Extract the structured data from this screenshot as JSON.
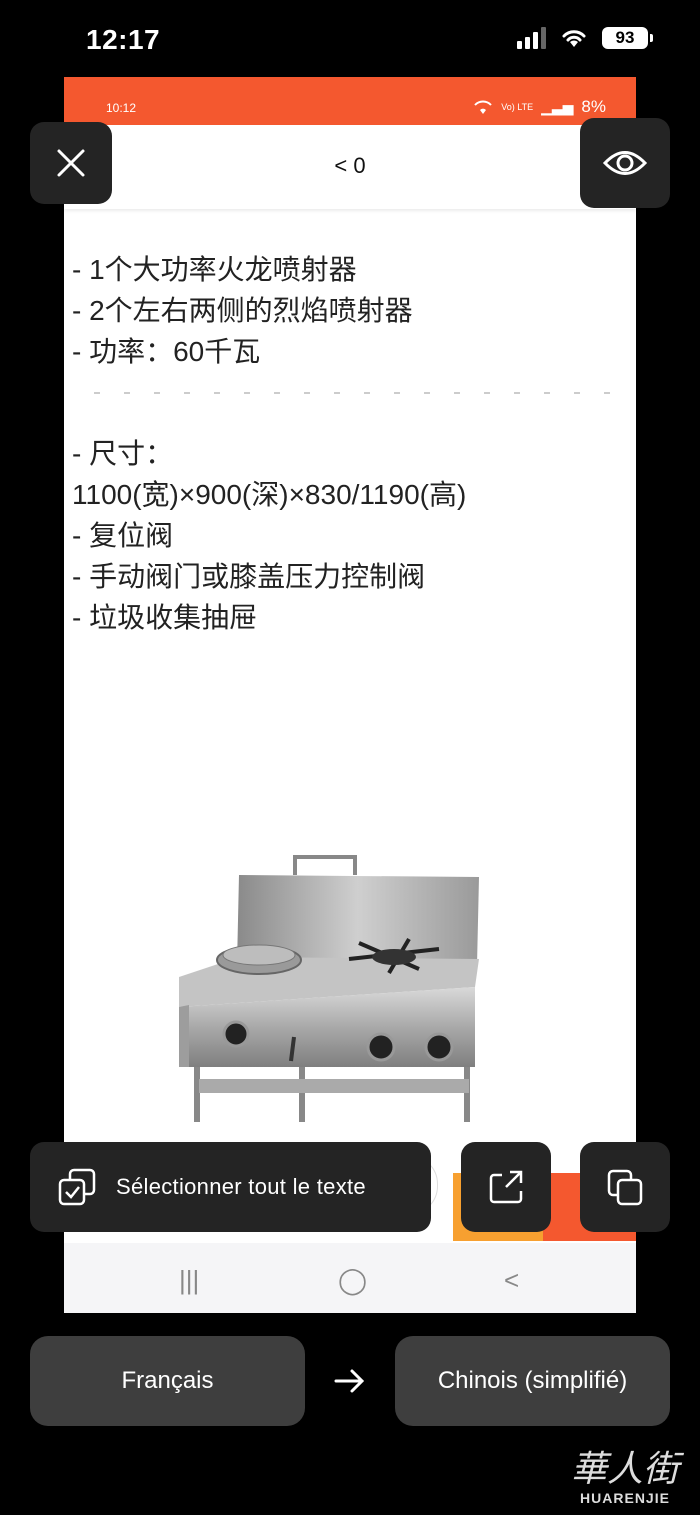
{
  "status_bar": {
    "time": "12:17",
    "battery": "93"
  },
  "screenshot": {
    "inner_status": {
      "time": "10:12",
      "battery": "8%",
      "network": "Vo) LTE"
    },
    "header": {
      "title": "< 0"
    },
    "content_lines": [
      "- 1个大功率火龙喷射器",
      "- 2个左右两侧的烈焰喷射器",
      "- 功率：60千瓦",
      "",
      "- 尺寸：",
      "1100(宽)×900(深)×830/1190(高)",
      "- 复位阀",
      "- 手动阀门或膝盖压力控制阀",
      "- 垃圾收集抽屉"
    ],
    "nav": {
      "recent": "|||",
      "home": "◯",
      "back": "<"
    }
  },
  "toolbar": {
    "select_all_label": "Sélectionner tout le texte"
  },
  "languages": {
    "from": "Français",
    "to": "Chinois (simplifié)"
  },
  "watermark": {
    "chars": "華人街",
    "latin": "HUARENJIE"
  },
  "icons": {
    "close": "close-icon",
    "eye": "eye-icon",
    "select_all": "select-all-icon",
    "share": "share-icon",
    "copy": "copy-icon",
    "arrow": "arrow-right-icon"
  },
  "colors": {
    "accent_orange": "#f4582f",
    "button_dark": "#242424",
    "lang_button": "#3e3e3e"
  }
}
